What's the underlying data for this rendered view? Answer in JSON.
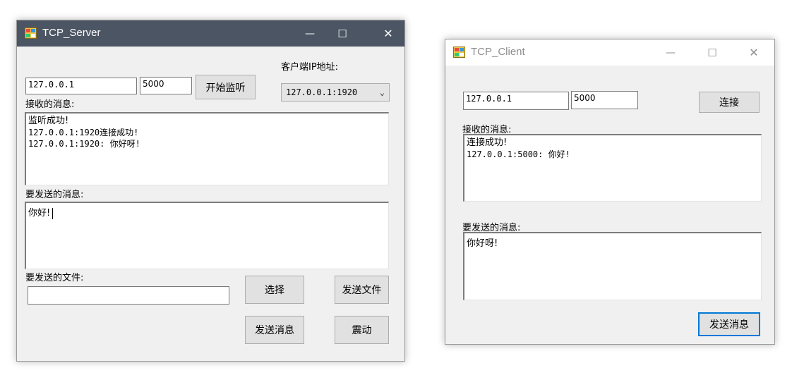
{
  "server": {
    "title": "TCP_Server",
    "controls": {
      "minimize": "—",
      "maximize": "☐",
      "close": "✕"
    },
    "client_ip_label": "客户端IP地址:",
    "ip_value": "127.0.0.1",
    "port_value": "5000",
    "listen_button": "开始监听",
    "client_select_value": "127.0.0.1:1920",
    "received_label": "接收的消息:",
    "received_lines": [
      "监听成功!",
      "127.0.0.1:1920连接成功!",
      "127.0.0.1:1920: 你好呀!"
    ],
    "send_label": "要发送的消息:",
    "send_value": "你好!",
    "file_label": "要发送的文件:",
    "file_value": "",
    "choose_button": "选择",
    "send_file_button": "发送文件",
    "send_message_button": "发送消息",
    "shake_button": "震动"
  },
  "client": {
    "title": "TCP_Client",
    "controls": {
      "minimize": "—",
      "maximize": "☐",
      "close": "✕"
    },
    "ip_value": "127.0.0.1",
    "port_value": "5000",
    "connect_button": "连接",
    "received_label": "接收的消息:",
    "received_lines": [
      "连接成功!",
      "127.0.0.1:5000: 你好!"
    ],
    "send_label": "要发送的消息:",
    "send_value": "你好呀!",
    "send_message_button": "发送消息"
  },
  "colors": {
    "active_titlebar": "#4b5563",
    "window_bg": "#f0f0f0",
    "focus_border": "#0078d7"
  },
  "icons": [
    "app-icon",
    "minimize-icon",
    "maximize-icon",
    "close-icon",
    "chevron-down-icon"
  ]
}
